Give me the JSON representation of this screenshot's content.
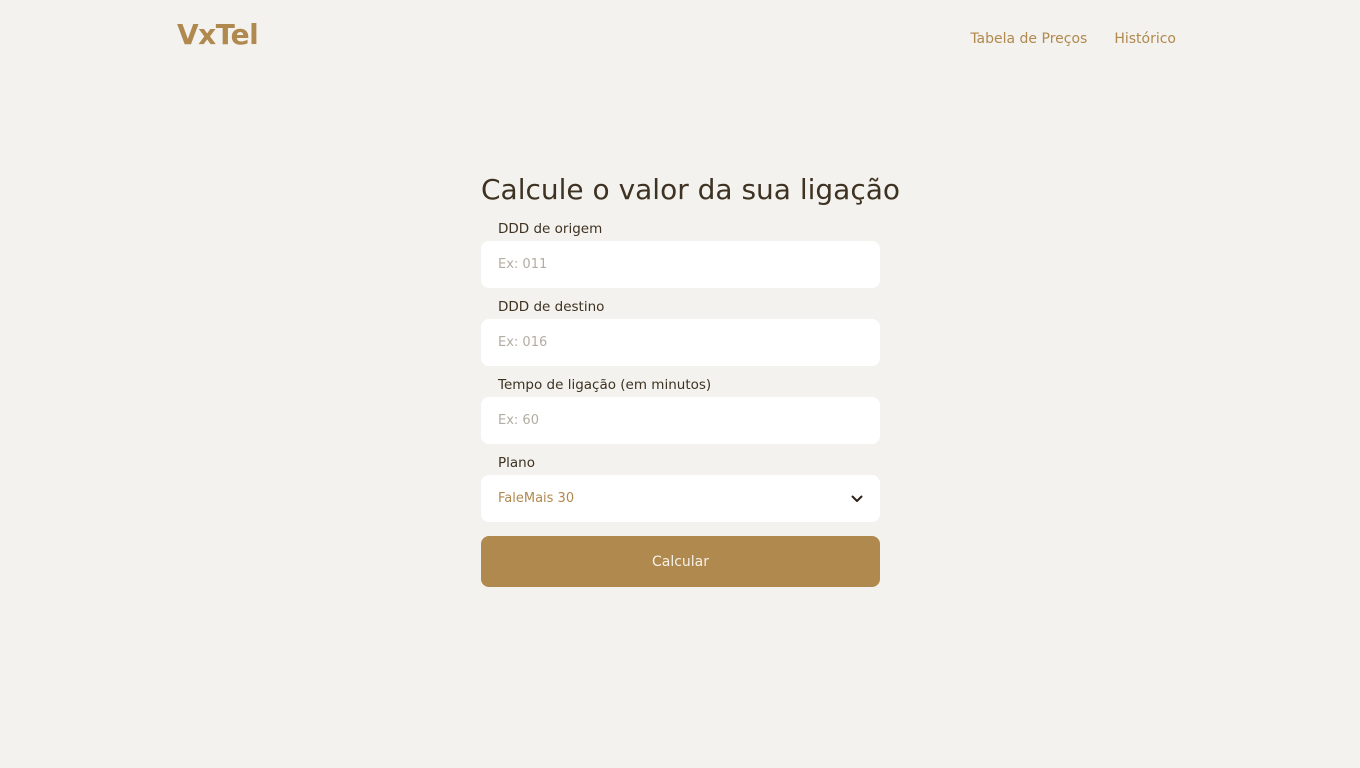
{
  "header": {
    "logo": "VxTel",
    "nav": [
      {
        "label": "Tabela de Preços"
      },
      {
        "label": "Histórico"
      }
    ]
  },
  "form": {
    "title": "Calcule o valor da sua ligação",
    "origin": {
      "label": "DDD de origem",
      "placeholder": "Ex: 011",
      "value": ""
    },
    "destination": {
      "label": "DDD de destino",
      "placeholder": "Ex: 016",
      "value": ""
    },
    "duration": {
      "label": "Tempo de ligação (em minutos)",
      "placeholder": "Ex: 60",
      "value": ""
    },
    "plan": {
      "label": "Plano",
      "selected": "FaleMais 30",
      "icon": "chevron-down-icon"
    },
    "submit_label": "Calcular"
  },
  "colors": {
    "background": "#f3f2ee",
    "accent": "#b0894f",
    "text": "#3e3222",
    "input_bg": "#ffffff"
  }
}
